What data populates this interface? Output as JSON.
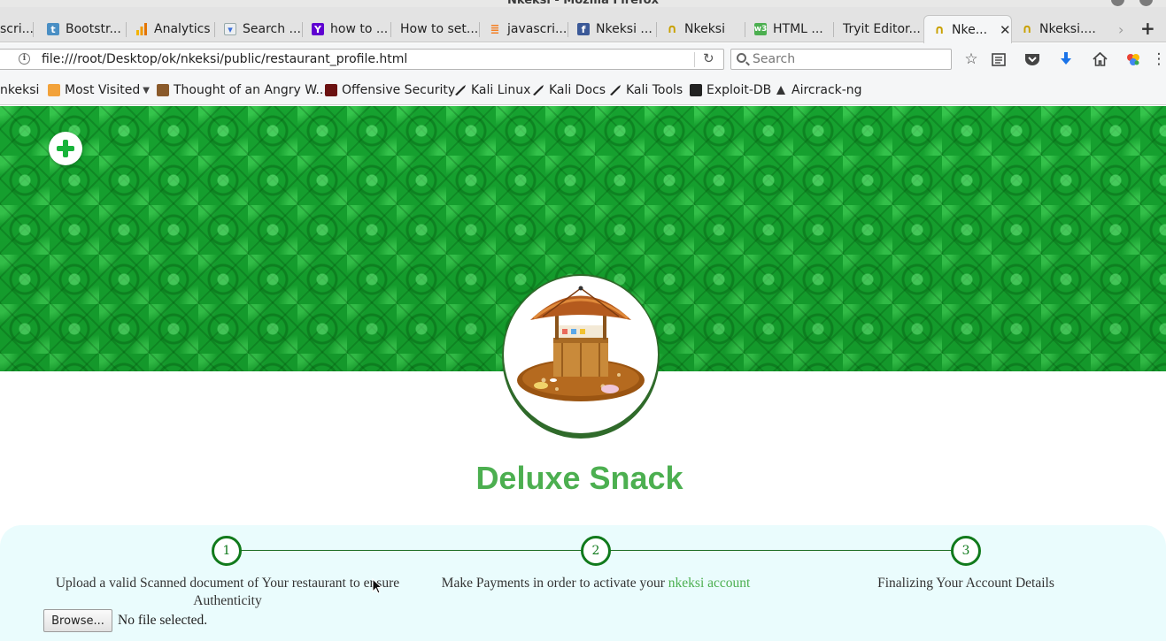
{
  "window": {
    "title": "Nkeksi - Mozilla Firefox"
  },
  "tabs": [
    {
      "label": "scri...",
      "icon": "generic-favicon"
    },
    {
      "label": "Bootstr...",
      "icon": "twitter-favicon"
    },
    {
      "label": "Analytics",
      "icon": "google-analytics-favicon"
    },
    {
      "label": "Search ...",
      "icon": "search-console-favicon"
    },
    {
      "label": "how to ...",
      "icon": "yahoo-favicon"
    },
    {
      "label": "How to set...",
      "icon": ""
    },
    {
      "label": "javascri...",
      "icon": "stackoverflow-favicon"
    },
    {
      "label": "Nkeksi ...",
      "icon": "facebook-favicon"
    },
    {
      "label": "Nkeksi",
      "icon": "headphones-favicon"
    },
    {
      "label": "HTML ...",
      "icon": "w3schools-favicon"
    },
    {
      "label": "Tryit Editor...",
      "icon": ""
    },
    {
      "label": "Nke...",
      "icon": "headphones-favicon",
      "active": true
    },
    {
      "label": "Nkeksi....",
      "icon": "headphones-favicon"
    }
  ],
  "navbar": {
    "url": "file:///root/Desktop/ok/nkeksi/public/restaurant_profile.html",
    "search_placeholder": "Search"
  },
  "bookmarks": [
    {
      "label": "nkeksi"
    },
    {
      "label": "Most Visited",
      "dropdown": true
    },
    {
      "label": "Thought of an Angry W..."
    },
    {
      "label": "Offensive Security"
    },
    {
      "label": "Kali Linux"
    },
    {
      "label": "Kali Docs"
    },
    {
      "label": "Kali Tools"
    },
    {
      "label": "Exploit-DB"
    },
    {
      "label": "Aircrack-ng"
    }
  ],
  "profile": {
    "restaurant_name": "Deluxe Snack",
    "accent_color": "#4caf50",
    "banner_color": "#17a832"
  },
  "steps": [
    {
      "number": "1",
      "text": "Upload a valid Scanned document of Your restaurant to ensure Authenticity"
    },
    {
      "number": "2",
      "text_before": "Make Payments in order to activate your ",
      "link": "nkeksi account"
    },
    {
      "number": "3",
      "text": "Finalizing Your Account Details"
    }
  ],
  "upload": {
    "button_label": "Browse...",
    "status": "No file selected."
  }
}
